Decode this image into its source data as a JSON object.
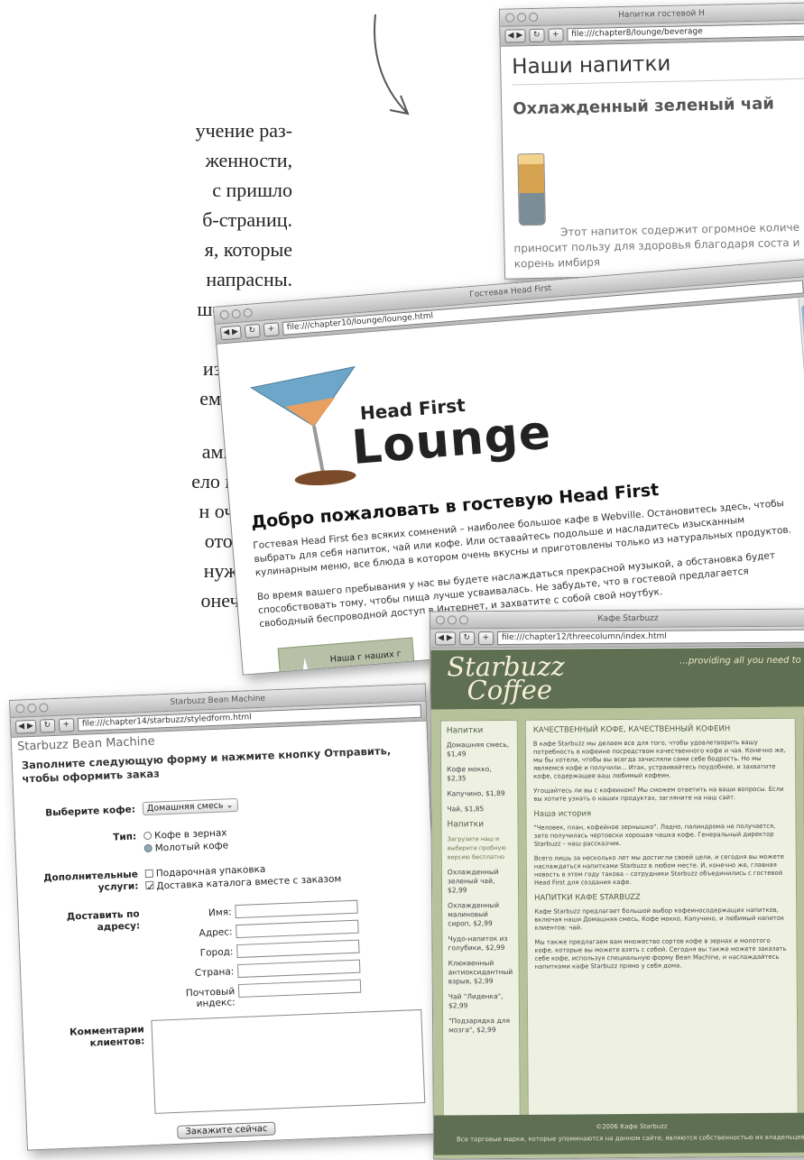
{
  "page_text": {
    "lines": [
      "учение раз-",
      "женности,",
      "с пришло",
      "б-страниц.",
      "я, которые",
      "напрасны.",
      "шее знание",
      "изучения",
      "изучением",
      "емся в сле-"
    ],
    "lines2": [
      "амировали",
      "ело в остав-",
      "н очень от-",
      "оторые вы",
      "нужно для",
      "онечно же,"
    ]
  },
  "beverages_window": {
    "title": "Напитки гостевой Н",
    "url": "file:///chapter8/lounge/beverage",
    "heading": "Наши напитки",
    "subheading": "Охлажденный зеленый чай",
    "description": "Этот напиток содержит огромное количе приносит пользу для здоровья благодаря соста и корень имбиря"
  },
  "lounge_window": {
    "title": "Гостевая Head First",
    "url": "file:///chapter10/lounge/lounge.html",
    "logo_small": "Head First",
    "logo_big": "Lounge",
    "welcome": "Добро пожаловать в гостевую Head First",
    "para1": "Гостевая Head First без всяких сомнений – наиболее большое кафе в Webville. Остановитесь здесь, чтобы выбрать для себя напиток, чай или кофе. Или оставайтесь подольше и насладитесь изысканным кулинарным меню, все блюда в котором очень вкусны и приготовлены только из натуральных продуктов.",
    "para2": "Во время вашего пребывания у нас вы будете наслаждаться прекрасной музыкой, а обстановка будет способствовать тому, чтобы пища лучше усваивалась. Не забудьте, что в гостевой предлагается свободный беспроводной доступ в Интернет, и захватите с собой свой ноутбук.",
    "promo": "Наша г наших г после"
  },
  "form_window": {
    "title": "Starbuzz Bean Machine",
    "url": "file:///chapter14/starbuzz/styledform.html",
    "heading": "Starbuzz Bean Machine",
    "intro": "Заполните следующую форму и нажмите кнопку Отправить, чтобы оформить заказ",
    "coffee_label": "Выберите кофе:",
    "coffee_value": "Домашняя смесь",
    "type_label": "Тип:",
    "type_opt1": "Кофе в зернах",
    "type_opt2": "Молотый кофе",
    "extra_label": "Дополнительные услуги:",
    "extra_opt1": "Подарочная упаковка",
    "extra_opt2": "Доставка каталога вместе с заказом",
    "ship_label": "Доставить по адресу:",
    "name_label": "Имя:",
    "address_label": "Адрес:",
    "city_label": "Город:",
    "country_label": "Страна:",
    "zip_label": "Почтовый индекс:",
    "comments_label": "Комментарии клиентов:",
    "submit": "Закажите сейчас"
  },
  "starbuzz_window": {
    "title": "Кафе Starbuzz",
    "url": "file:///chapter12/threecolumn/index.html",
    "logo1": "Starbuzz",
    "logo2": "Coffee",
    "tagline": "...providing all you need to life.",
    "sidebar_heading": "Напитки",
    "sidebar_items": [
      "Домашняя смесь, $1,49",
      "Кофе мокко, $2,35",
      "Капучино, $1,89",
      "Чай, $1,85"
    ],
    "sidebar_heading2": "Напитки",
    "sidebar_note": "Загрузите наш и выберите пробную версию бесплатно",
    "sidebar_items2": [
      "Охлажденный зеленый чай, $2,99",
      "Охлажденный малиновый сироп, $2,99",
      "Чудо-напиток из голубики, $2,99",
      "Клюквенный антиоксидантный взрыв, $2,99",
      "Чай \"Лиденка\", $2,99",
      "\"Подзарядка для мозга\", $2,99"
    ],
    "main_heading": "КАЧЕСТВЕННЫЙ КОФЕ, КАЧЕСТВЕННЫЙ КОФЕИН",
    "main_p1": "В кафе Starbuzz мы делаем все для того, чтобы удовлетворить вашу потребность в кофеине посредством качественного кофе и чая. Конечно же, мы бы хотели, чтобы вы всегда зачисляли сами себе бодрость. Но мы являемся кофе и получили... Итак, устраивайтесь поудобнее, и захватите кофе, содержащее ваш любимый кофеин.",
    "main_p2": "Угощайтесь ли вы с кофеином? Мы сможем ответить на ваши вопросы. Если вы хотите узнать о наших продуктах, загляните на наш сайт.",
    "history_heading": "Наша история",
    "history_p": "\"Человек, план, кофейное зернышко\". Ладно, палиндрома не получается, зато получилась чертовски хорошая чашка кофе. Генеральный директор Starbuzz – наш рассказчик.",
    "history_p2": "Всего лишь за несколько лет мы достигли своей цели, и сегодня вы можете наслаждаться напитками Starbuzz в любом месте. И, конечно же, главная новость в этом году такова – сотрудники Starbuzz объединились с гостевой Head First для создания кафе.",
    "beans_heading": "НАПИТКИ КАФЕ STARBUZZ",
    "beans_p": "Кафе Starbuzz предлагает большой выбор кофеиносодержащих напитков, включая наши Домашняя смесь, Кофе мокко, Капучино, и любимый напиток клиентов: чай.",
    "beans_p2": "Мы также предлагаем вам множество сортов кофе в зернах и молотого кофе, которые вы можете взять с собой. Сегодня вы также можете заказать себе кофе, используя специальную форму Bean Machine, и наслаждайтесь напитками кафе Starbuzz прямо у себя дома.",
    "footer1": "©2006 Кафе Starbuzz",
    "footer2": "Все торговые марки, которые упоминаются на данном сайте, являются собственностью их владельцев."
  },
  "colors": {
    "starbuzz_green": "#5e6f52",
    "starbuzz_bg": "#b7c29a",
    "panel": "#eef0e2"
  }
}
